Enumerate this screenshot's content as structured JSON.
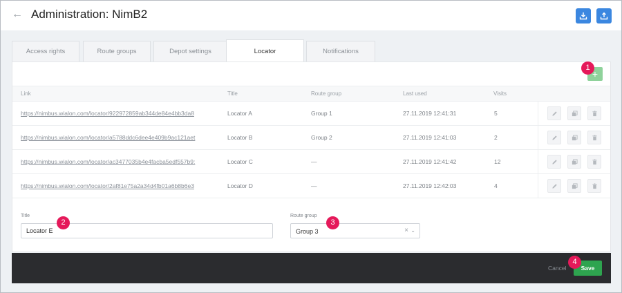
{
  "header": {
    "title": "Administration: NimB2",
    "back_icon": "←"
  },
  "tabs": [
    {
      "label": "Access rights"
    },
    {
      "label": "Route groups"
    },
    {
      "label": "Depot settings"
    },
    {
      "label": "Locator",
      "active": true
    },
    {
      "label": "Notifications"
    }
  ],
  "table": {
    "add_label": "+",
    "columns": [
      "Link",
      "Title",
      "Route group",
      "Last used",
      "Visits"
    ],
    "rows": [
      {
        "link": "https://nimbus.wialon.com/locator/922972859ab344de84e4bb3da8",
        "title": "Locator A",
        "group": "Group 1",
        "last_used": "27.11.2019 12:41:31",
        "visits": "5"
      },
      {
        "link": "https://nimbus.wialon.com/locator/a5788ddc6dee4e409b9ac121aet",
        "title": "Locator B",
        "group": "Group 2",
        "last_used": "27.11.2019 12:41:03",
        "visits": "2"
      },
      {
        "link": "https://nimbus.wialon.com/locator/ac3477035b4e4facba5edf557b9:",
        "title": "Locator C",
        "group": "—",
        "last_used": "27.11.2019 12:41:42",
        "visits": "12"
      },
      {
        "link": "https://nimbus.wialon.com/locator/2af81e75a2a34d4fb01a6b8b6e3",
        "title": "Locator D",
        "group": "—",
        "last_used": "27.11.2019 12:42:03",
        "visits": "4"
      }
    ]
  },
  "form": {
    "title_label": "Title",
    "title_value": "Locator E",
    "group_label": "Route group",
    "group_value": "Group 3",
    "clear_icon": "×",
    "chevron_icon": "⌄"
  },
  "footer": {
    "cancel_label": "Cancel",
    "save_label": "Save"
  },
  "badges": [
    "1",
    "2",
    "3",
    "4"
  ],
  "colors": {
    "primary": "#3b87e0",
    "add_button": "#8fd29b",
    "save_button": "#2ea44f",
    "footer_bg": "#2b2c2f",
    "badge": "#e5195a"
  }
}
